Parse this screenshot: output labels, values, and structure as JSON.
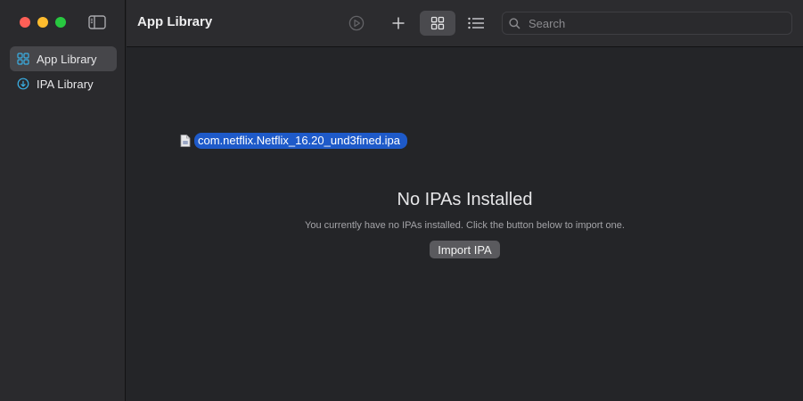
{
  "window": {
    "title": "App Library"
  },
  "sidebar": {
    "items": [
      {
        "label": "App Library",
        "icon": "app-grid-icon",
        "active": true
      },
      {
        "label": "IPA Library",
        "icon": "download-circle-icon",
        "active": false
      }
    ]
  },
  "toolbar": {
    "icons": [
      "play-icon",
      "plus-icon",
      "grid-view-icon",
      "list-view-icon"
    ],
    "search": {
      "placeholder": "Search",
      "value": ""
    }
  },
  "content": {
    "dragged_file": "com.netflix.Netflix_16.20_und3fined.ipa",
    "empty_title": "No IPAs Installed",
    "empty_description": "You currently have no IPAs installed. Click the button below to import one.",
    "import_button": "Import IPA"
  },
  "colors": {
    "accent": "#1e5ac9",
    "sidebar_icon": "#3ab0e6",
    "traffic_red": "#fe5f57",
    "traffic_yellow": "#febc2e",
    "traffic_green": "#28c840"
  }
}
